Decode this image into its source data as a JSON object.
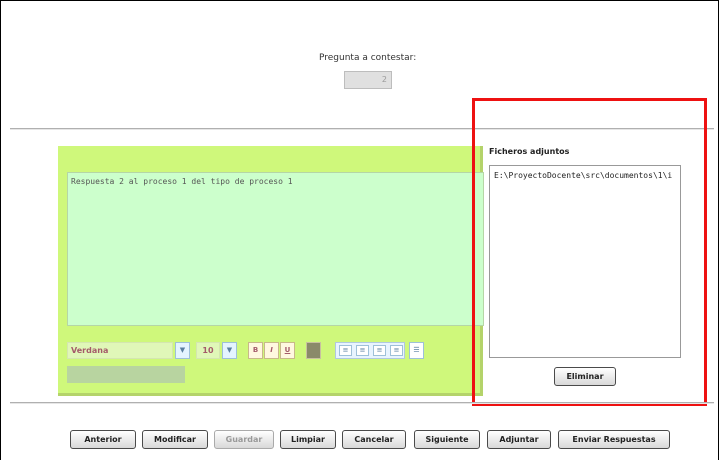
{
  "question": {
    "label": "Pregunta a contestar:",
    "value": "2"
  },
  "editor": {
    "content": "Respuesta 2 al proceso 1 del tipo de proceso 1",
    "font_name": "Verdana",
    "font_size": "10",
    "bold_label": "B",
    "italic_label": "I",
    "underline_label": "U"
  },
  "attachments": {
    "title": "Ficheros adjuntos",
    "items": [
      "E:\\ProyectoDocente\\src\\documentos\\1\\i"
    ],
    "delete_label": "Eliminar"
  },
  "actions": {
    "anterior": "Anterior",
    "modificar": "Modificar",
    "guardar": "Guardar",
    "limpiar": "Limpiar",
    "cancelar": "Cancelar",
    "siguiente": "Siguiente",
    "adjuntar": "Adjuntar",
    "enviar": "Enviar Respuestas"
  },
  "colors": {
    "panel_bg": "#cff87b",
    "editor_bg": "#ccffcc",
    "highlight": "#ee1111"
  }
}
